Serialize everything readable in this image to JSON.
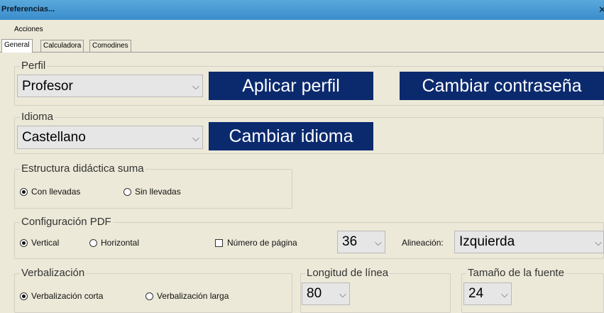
{
  "window": {
    "title": "Preferencias...",
    "close_glyph": "✕"
  },
  "menubar": {
    "items": [
      "Acciones"
    ]
  },
  "tabs": [
    "General",
    "Calculadora",
    "Comodines"
  ],
  "perfil": {
    "group_label": "Perfil",
    "selected": "Profesor",
    "apply_label": "Aplicar perfil",
    "change_password_label": "Cambiar contraseña"
  },
  "idioma": {
    "group_label": "Idioma",
    "selected": "Castellano",
    "change_label": "Cambiar idioma"
  },
  "estructura": {
    "group_label": "Estructura didáctica suma",
    "options": [
      "Con llevadas",
      "Sin llevadas"
    ],
    "selected_index": 0
  },
  "pdf": {
    "group_label": "Configuración PDF",
    "orientation_options": [
      "Vertical",
      "Horizontal"
    ],
    "orientation_selected_index": 0,
    "page_number_label": "Número de página",
    "page_number_checked": false,
    "font_size": "36",
    "alignment_label": "Alineación:",
    "alignment": "Izquierda"
  },
  "verbalizacion": {
    "group_label": "Verbalización",
    "options": [
      "Verbalización corta",
      "Verbalización larga"
    ],
    "selected_index": 0
  },
  "longitud": {
    "group_label": "Longitud de línea",
    "selected": "80"
  },
  "tamano": {
    "group_label": "Tamaño de la fuente",
    "selected": "24"
  },
  "colors": {
    "titlebar": "#3A8DCB",
    "button": "#0B2A6E",
    "panel": "#ECE9D8"
  },
  "icons": {
    "dropdown": "chevron-down-icon",
    "close": "close-icon"
  }
}
